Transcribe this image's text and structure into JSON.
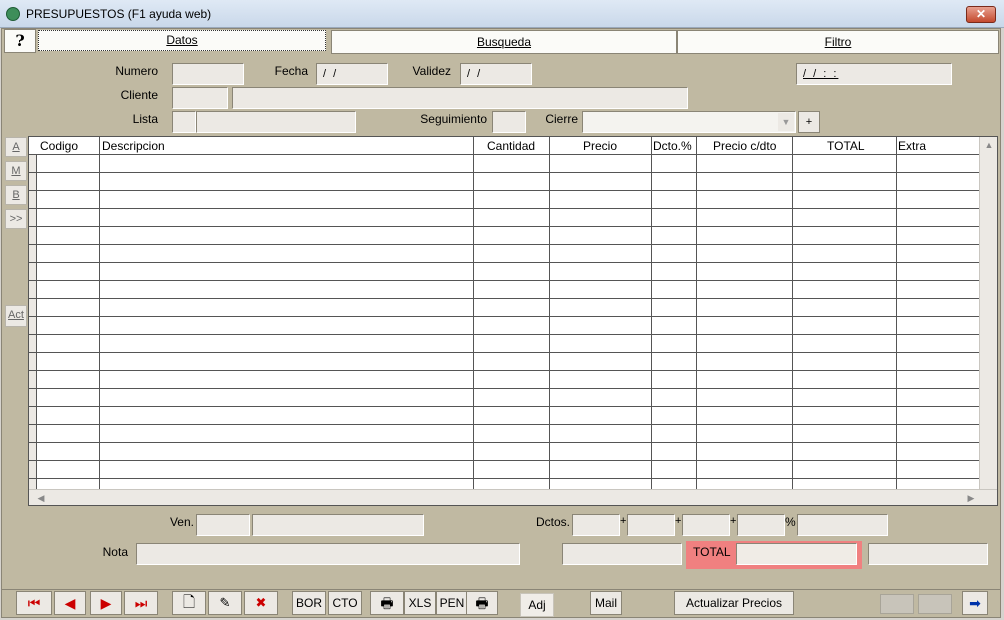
{
  "window": {
    "title": "PRESUPUESTOS (F1 ayuda web)",
    "close": "✕"
  },
  "tabs": {
    "help": "?",
    "datos": "Datos",
    "busqueda": "Busqueda",
    "filtro": "Filtro"
  },
  "form": {
    "numero_label": "Numero",
    "fecha_label": "Fecha",
    "fecha_value": "/ /",
    "validez_label": "Validez",
    "validez_value": "/ /",
    "datetime_value": "/ /   : :",
    "cliente_label": "Cliente",
    "lista_label": "Lista",
    "seguimiento_label": "Seguimiento",
    "cierre_label": "Cierre",
    "plus_label": "+"
  },
  "side_buttons": [
    "A",
    "M",
    "B",
    ">>",
    "Act"
  ],
  "table": {
    "columns": [
      "Codigo",
      "Descripcion",
      "Cantidad",
      "Precio",
      "Dcto.%",
      "Precio c/dto",
      "TOTAL",
      "Extra"
    ]
  },
  "footer": {
    "ven_label": "Ven.",
    "dctos_label": "Dctos.",
    "plus": "+",
    "percent": "%",
    "nota_label": "Nota",
    "total_label": "TOTAL"
  },
  "toolbar": {
    "bor": "BOR",
    "cto": "CTO",
    "xls": "XLS",
    "pen": "PEN",
    "adj": "Adj",
    "mail": "Mail",
    "actualizar": "Actualizar Precios"
  },
  "colors": {
    "total_highlight": "#f08080",
    "window_bg": "#c0b9a2"
  }
}
